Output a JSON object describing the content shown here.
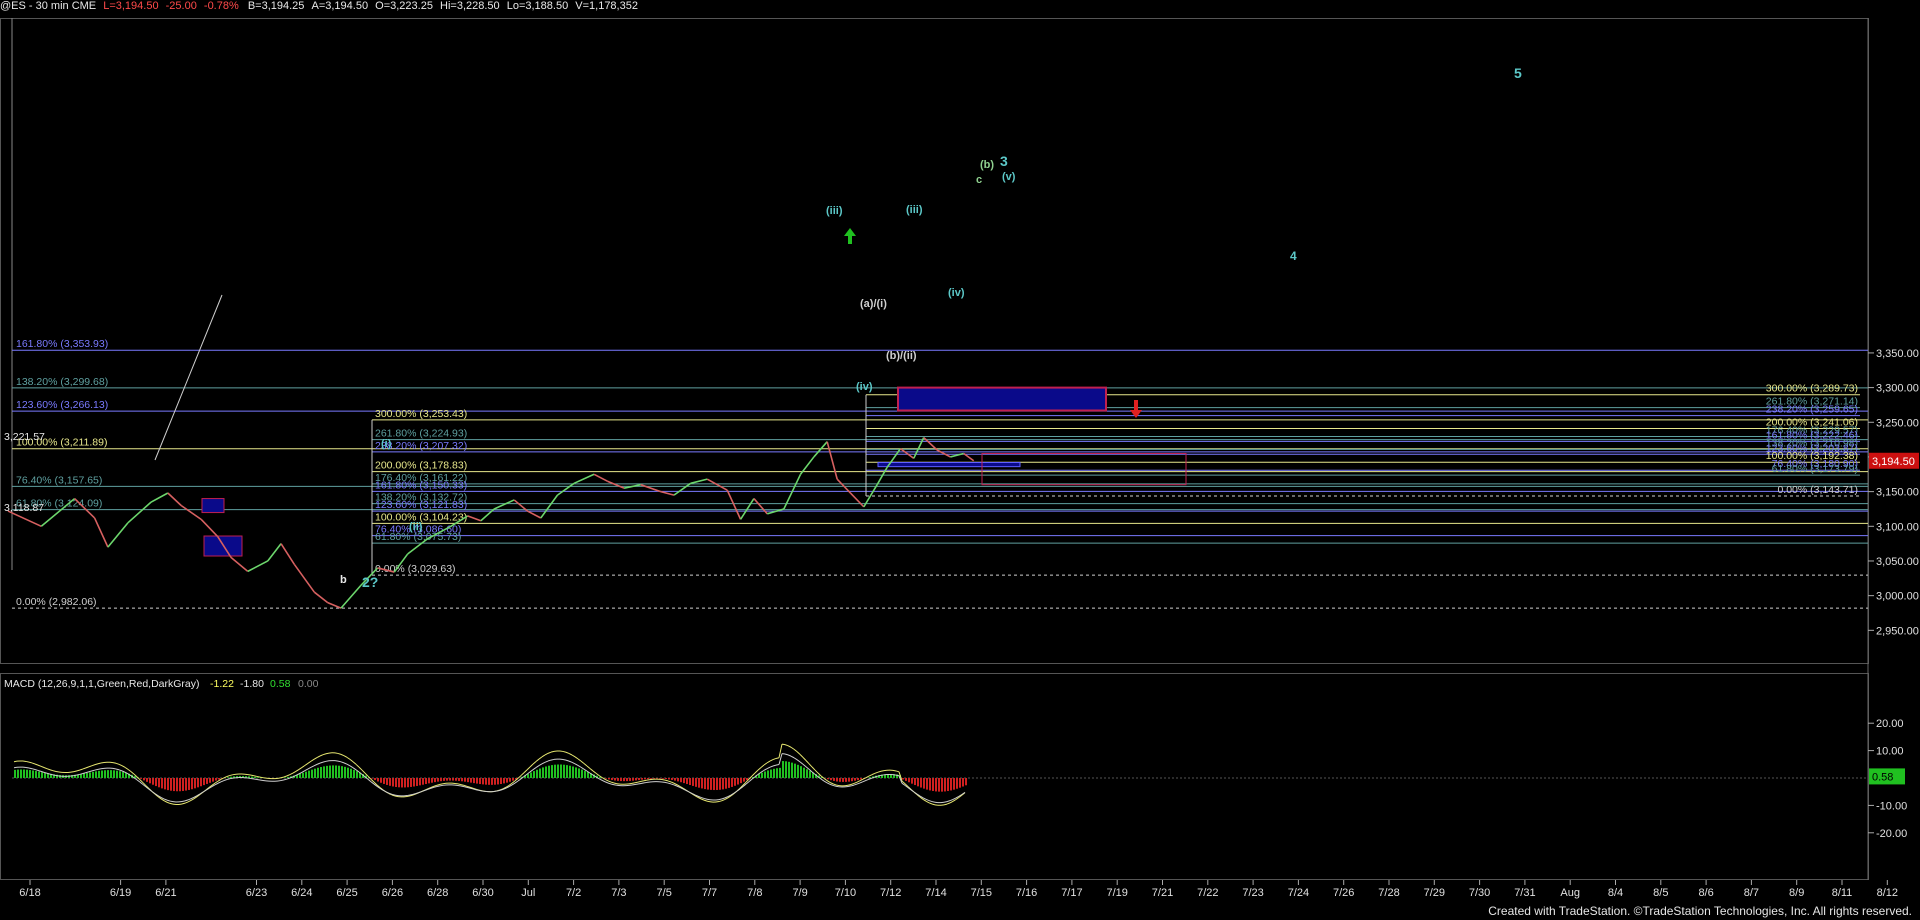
{
  "header": {
    "symbol": "@ES - 30 min  CME",
    "last": "L=3,194.50",
    "change": "-25.00",
    "change_pct": "-0.78%",
    "bid": "B=3,194.25",
    "ask": "A=3,194.50",
    "open": "O=3,223.25",
    "high": "Hi=3,228.50",
    "low": "Lo=3,188.50",
    "volume": "V=1,178,352"
  },
  "footer": "Created with TradeStation. ©TradeStation Technologies, Inc. All rights reserved.",
  "colors": {
    "background": "#000000",
    "up_bar": "#6cd66c",
    "down_bar": "#d66060",
    "blue_fib": "#7a7aff",
    "yellow_fib": "#e8e88c",
    "teal_fib": "#5fa0a0",
    "red_fib": "#c83a60",
    "cyan_label": "#5cc8c8"
  },
  "chart_data": [
    {
      "type": "line",
      "name": "price",
      "title": "@ES - 30 min",
      "ylim": [
        2900,
        3400
      ],
      "y_ticks": [
        "3,350.00",
        "3,300.00",
        "3,250.00",
        "3,200.00",
        "3,150.00",
        "3,100.00",
        "3,050.00",
        "3,000.00",
        "2,950.00"
      ],
      "y_tick_values": [
        3350,
        3300,
        3250,
        3200,
        3150,
        3100,
        3050,
        3000,
        2950
      ],
      "last_price_label": "3,194.50",
      "x_labels": [
        "6/18",
        "6/19",
        "6/21",
        "6/23",
        "6/24",
        "6/25",
        "6/26",
        "6/28",
        "6/30",
        "Jul",
        "7/2",
        "7/3",
        "7/5",
        "7/7",
        "7/8",
        "7/9",
        "7/10",
        "7/12",
        "7/14",
        "7/15",
        "7/16",
        "7/17",
        "7/19",
        "7/21",
        "7/22",
        "7/23",
        "7/24",
        "7/26",
        "7/28",
        "7/29",
        "7/30",
        "7/31",
        "Aug",
        "8/4",
        "8/5",
        "8/6",
        "8/7",
        "8/9",
        "8/11",
        "8/12"
      ],
      "x_label_index": [
        0,
        2,
        3,
        5,
        6,
        7,
        8,
        9,
        10,
        11,
        12,
        13,
        14,
        15,
        16,
        17,
        18,
        19,
        20,
        21,
        22,
        23,
        24,
        25,
        26,
        27,
        28,
        29,
        30,
        31,
        32,
        33,
        34,
        35,
        36,
        37,
        38,
        39,
        40,
        41
      ],
      "price_path": [
        [
          0,
          3122
        ],
        [
          1,
          3100
        ],
        [
          2,
          3140
        ],
        [
          2.6,
          3112
        ],
        [
          3,
          3070
        ],
        [
          3.6,
          3105
        ],
        [
          4.3,
          3135
        ],
        [
          4.8,
          3148
        ],
        [
          5.2,
          3130
        ],
        [
          5.8,
          3110
        ],
        [
          6.3,
          3085
        ],
        [
          6.7,
          3055
        ],
        [
          7.2,
          3035
        ],
        [
          7.8,
          3050
        ],
        [
          8.2,
          3075
        ],
        [
          8.6,
          3045
        ],
        [
          9.2,
          3005
        ],
        [
          9.6,
          2990
        ],
        [
          10,
          2982
        ],
        [
          10.6,
          3015
        ],
        [
          11.1,
          3040
        ],
        [
          11.6,
          3034
        ],
        [
          12,
          3060
        ],
        [
          12.6,
          3082
        ],
        [
          13.3,
          3100
        ],
        [
          13.8,
          3115
        ],
        [
          14.2,
          3108
        ],
        [
          14.6,
          3125
        ],
        [
          15.2,
          3138
        ],
        [
          15.6,
          3122
        ],
        [
          16,
          3112
        ],
        [
          16.5,
          3145
        ],
        [
          17,
          3162
        ],
        [
          17.6,
          3175
        ],
        [
          18,
          3165
        ],
        [
          18.5,
          3155
        ],
        [
          19,
          3160
        ],
        [
          19.6,
          3150
        ],
        [
          20,
          3145
        ],
        [
          20.5,
          3162
        ],
        [
          21,
          3168
        ],
        [
          21.6,
          3152
        ],
        [
          22,
          3110
        ],
        [
          22.4,
          3140
        ],
        [
          22.8,
          3118
        ],
        [
          23.3,
          3125
        ],
        [
          23.8,
          3175
        ],
        [
          24.2,
          3200
        ],
        [
          24.6,
          3222
        ],
        [
          24.9,
          3168
        ],
        [
          25.3,
          3148
        ],
        [
          25.7,
          3128
        ],
        [
          26.1,
          3160
        ],
        [
          26.4,
          3185
        ],
        [
          26.8,
          3212
        ],
        [
          27.2,
          3198
        ],
        [
          27.5,
          3228
        ],
        [
          27.9,
          3210
        ],
        [
          28.3,
          3200
        ],
        [
          28.7,
          3205
        ],
        [
          29,
          3194.5
        ]
      ],
      "last_index": 29,
      "fib_levels": [
        {
          "label": "161.80% (3,353.93)",
          "value": 3353.93,
          "color": "blue"
        },
        {
          "label": "138.20% (3,299.68)",
          "value": 3299.68,
          "color": "teal"
        },
        {
          "label": "123.60% (3,266.13)",
          "value": 3266.13,
          "color": "blue"
        },
        {
          "label": "100.00% (3,211.89)",
          "value": 3211.89,
          "color": "yellow"
        },
        {
          "label": "76.40% (3,157.65)",
          "value": 3157.65,
          "color": "teal"
        },
        {
          "label": "61.80% (3,124.09)",
          "value": 3124.09,
          "color": "teal"
        },
        {
          "label": "0.00% (2,982.06)",
          "value": 2982.06,
          "color": "white"
        },
        {
          "label": "300.00% (3,253.43)",
          "value": 3253.43,
          "color": "yellow"
        },
        {
          "label": "261.80% (3,224.93)",
          "value": 3224.93,
          "color": "teal"
        },
        {
          "label": "238.20% (3,207.32)",
          "value": 3207.32,
          "color": "blue"
        },
        {
          "label": "200.00% (3,178.83)",
          "value": 3178.83,
          "color": "yellow"
        },
        {
          "label": "176.40% (3,161.22)",
          "value": 3161.22,
          "color": "teal"
        },
        {
          "label": "161.80% (3,150.33)",
          "value": 3150.33,
          "color": "blue"
        },
        {
          "label": "138.20% (3,132.72)",
          "value": 3132.72,
          "color": "teal"
        },
        {
          "label": "123.60% (3,121.83)",
          "value": 3121.83,
          "color": "blue"
        },
        {
          "label": "100.00% (3,104.23)",
          "value": 3104.23,
          "color": "yellow"
        },
        {
          "label": "76.40% (3,086.60)",
          "value": 3086.6,
          "color": "blue"
        },
        {
          "label": "61.80% (3,075.73)",
          "value": 3075.73,
          "color": "teal"
        },
        {
          "label": "0.00% (3,029.63)",
          "value": 3029.63,
          "color": "white"
        },
        {
          "label": "300.00% (3,289.73)",
          "value": 3289.73,
          "color": "yellow"
        },
        {
          "label": "261.80% (3,271.14)",
          "value": 3271.14,
          "color": "teal"
        },
        {
          "label": "238.20% (3,259.65)",
          "value": 3259.65,
          "color": "blue"
        },
        {
          "label": "200.00% (3,241.06)",
          "value": 3241.06,
          "color": "yellow"
        },
        {
          "label": "176.40% (3,229.57)",
          "value": 3229.57,
          "color": "teal"
        },
        {
          "label": "161.80% (3,222.46)",
          "value": 3222.46,
          "color": "blue"
        },
        {
          "label": "138.20% (3,210.98)",
          "value": 3210.98,
          "color": "teal"
        },
        {
          "label": "123.60% (3,203.87)",
          "value": 3203.87,
          "color": "blue"
        },
        {
          "label": "100.00% (3,192.38)",
          "value": 3192.38,
          "color": "yellow"
        },
        {
          "label": "76.40% (3,180.90)",
          "value": 3180.9,
          "color": "blue"
        },
        {
          "label": "61.80% (3,173.79)",
          "value": 3173.79,
          "color": "teal"
        },
        {
          "label": "0.00% (3,143.71)",
          "value": 3143.71,
          "color": "white"
        }
      ],
      "price_marks": [
        {
          "label": "3,221.57",
          "value": 3221.57
        },
        {
          "label": "3,118.87",
          "value": 3118.87
        }
      ],
      "wave_labels": [
        "5",
        "3",
        "(b)",
        "c",
        "(v)",
        "4",
        "(iii)",
        "(iii)",
        "(a)/(i)",
        "(b)/(ii)",
        "(iv)",
        "(iv)",
        "(i)",
        "(ii)",
        "b",
        "2?"
      ]
    },
    {
      "type": "line",
      "name": "macd",
      "title": "MACD (12,26,9,1,1,Green,Red,DarkGray)",
      "values_text": [
        "-1.22",
        "-1.80",
        "0.58",
        "0.00"
      ],
      "ylim": [
        -25,
        25
      ],
      "y_ticks": [
        "20.00",
        "10.00",
        "-10.00",
        "-20.00"
      ],
      "y_tick_values": [
        20,
        10,
        -10,
        -20
      ],
      "last_value_label": "0.58"
    }
  ]
}
